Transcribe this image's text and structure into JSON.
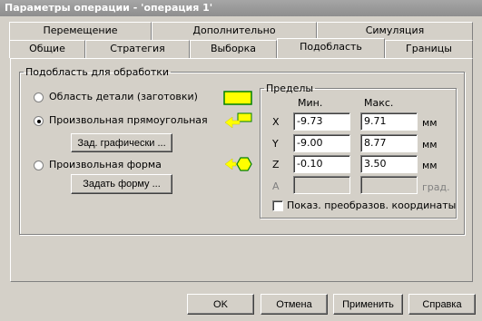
{
  "window": {
    "title": "Параметры операции - 'операция 1'"
  },
  "tabs_back": [
    {
      "label": "Перемещение"
    },
    {
      "label": "Дополнительно"
    },
    {
      "label": "Симуляция"
    }
  ],
  "tabs_front": [
    {
      "label": "Общие"
    },
    {
      "label": "Стратегия"
    },
    {
      "label": "Выборка"
    },
    {
      "label": "Подобласть"
    },
    {
      "label": "Границы"
    }
  ],
  "active_tab": "Подобласть",
  "subregion": {
    "group_label": "Подобласть для обработки",
    "options": [
      {
        "label": "Область детали (заготовки)",
        "selected": false,
        "icon": "part-area-icon"
      },
      {
        "label": "Произвольная прямоугольная",
        "selected": true,
        "icon": "rectangle-arrow-icon"
      },
      {
        "label": "Произвольная форма",
        "selected": false,
        "icon": "hexagon-arrow-icon"
      }
    ],
    "graphic_button": "Зад. графически ...",
    "shape_button": "Задать форму ...",
    "accent_color": "#ffff00"
  },
  "limits": {
    "group_label": "Пределы",
    "min_header": "Мин.",
    "max_header": "Макс.",
    "rows": [
      {
        "axis": "X",
        "min": "-9.73",
        "max": "9.71",
        "unit": "мм",
        "enabled": true
      },
      {
        "axis": "Y",
        "min": "-9.00",
        "max": "8.77",
        "unit": "мм",
        "enabled": true
      },
      {
        "axis": "Z",
        "min": "-0.10",
        "max": "3.50",
        "unit": "мм",
        "enabled": true
      },
      {
        "axis": "A",
        "min": "",
        "max": "",
        "unit": "град.",
        "enabled": false
      }
    ],
    "show_transform_label": "Показ. преобразов. координаты",
    "show_transform_checked": false
  },
  "footer": {
    "ok": "OK",
    "cancel": "Отмена",
    "apply": "Применить",
    "help": "Справка"
  }
}
